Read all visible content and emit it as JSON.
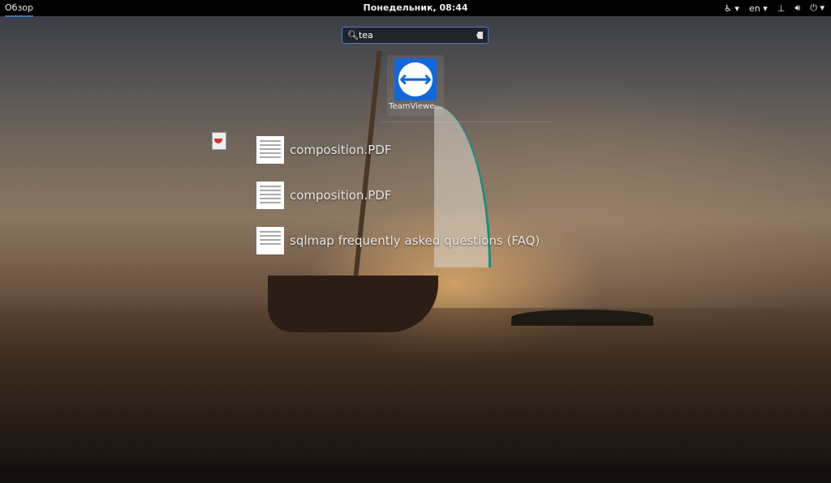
{
  "topbar": {
    "activities": "Обзор",
    "clock": "Понедельник, 08:44",
    "language": "en"
  },
  "search": {
    "value": "tea"
  },
  "apps": [
    {
      "label": "TeamViewe...",
      "icon": "teamviewer-icon"
    }
  ],
  "documents": [
    {
      "title": "composition.PDF"
    },
    {
      "title": "composition.PDF"
    },
    {
      "title": "sqlmap frequently asked questions (FAQ)"
    }
  ]
}
